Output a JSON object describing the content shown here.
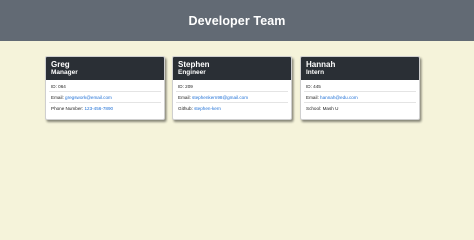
{
  "header": {
    "title": "Developer Team"
  },
  "cards": [
    {
      "name": "Greg",
      "role": "Manager",
      "id_label": "ID:",
      "id": "064",
      "email_label": "Email:",
      "email": "gregswork@email.com",
      "extra_label": "Phone Number:",
      "extra": "123-456-7890"
    },
    {
      "name": "Stephen",
      "role": "Engineer",
      "id_label": "ID:",
      "id": "209",
      "email_label": "Email:",
      "email": "stephenkern98@gmail.com",
      "extra_label": "Github:",
      "extra": "stephen-kern"
    },
    {
      "name": "Hannah",
      "role": "Intern",
      "id_label": "ID:",
      "id": "445",
      "email_label": "Email:",
      "email": "hannah@edu.com",
      "extra_label": "School:",
      "extra": "Mash U"
    }
  ],
  "colors": {
    "page_bg": "#f5f3da",
    "header_bg": "#626a74",
    "card_head_bg": "#2a2f35",
    "link": "#1d6fd6"
  }
}
